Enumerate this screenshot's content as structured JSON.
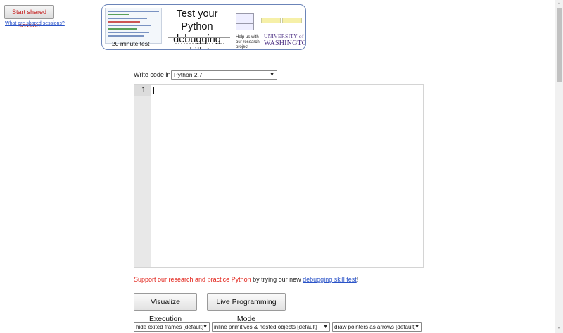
{
  "header": {
    "share_button": "Start shared session",
    "share_link": "What are shared sessions?"
  },
  "banner": {
    "title": "Test your Python debugging skills!",
    "duration": "20 minute test",
    "help": "Help us with our research project",
    "uni_line1": "UNIVERSITY of",
    "uni_line2": "WASHINGTON"
  },
  "editor": {
    "lang_label": "Write code in",
    "lang_value": "Python 2.7",
    "line_number": "1"
  },
  "support": {
    "red_text": "Support our research and practice Python",
    "middle": " by trying our new ",
    "link": "debugging skill test",
    "end": "!"
  },
  "buttons": {
    "visualize": "Visualize Execution",
    "live": "Live Programming Mode"
  },
  "options": {
    "frames": "hide exited frames [default]",
    "primitives": "inline primitives & nested objects [default]",
    "pointers": "draw pointers as arrows [default]"
  }
}
